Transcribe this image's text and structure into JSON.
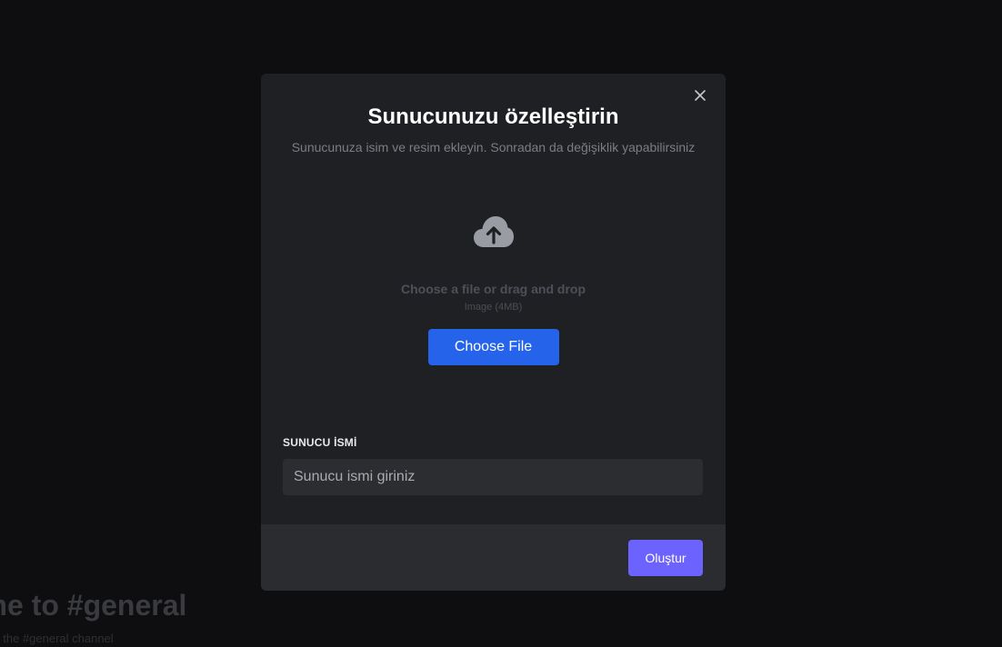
{
  "background": {
    "welcome_title": "ome to #general",
    "welcome_subtitle": "art of the #general channel"
  },
  "modal": {
    "title": "Sunucunuzu özelleştirin",
    "subtitle": "Sunucunuza isim ve resim ekleyin. Sonradan da değişiklik yapabilirsiniz",
    "close_icon": "close-icon",
    "upload": {
      "icon": "cloud-upload-icon",
      "prompt": "Choose a file or drag and drop",
      "hint": "Image (4MB)",
      "button_label": "Choose File"
    },
    "server_name": {
      "label": "SUNUCU İSMİ",
      "placeholder": "Sunucu ismi giriniz",
      "value": ""
    },
    "footer": {
      "create_label": "Oluştur"
    }
  },
  "colors": {
    "primary_button": "#2563eb",
    "create_button": "#6c63ff",
    "modal_bg": "#1f2023",
    "footer_bg": "#2b2c30",
    "page_bg": "#0e0e10"
  }
}
